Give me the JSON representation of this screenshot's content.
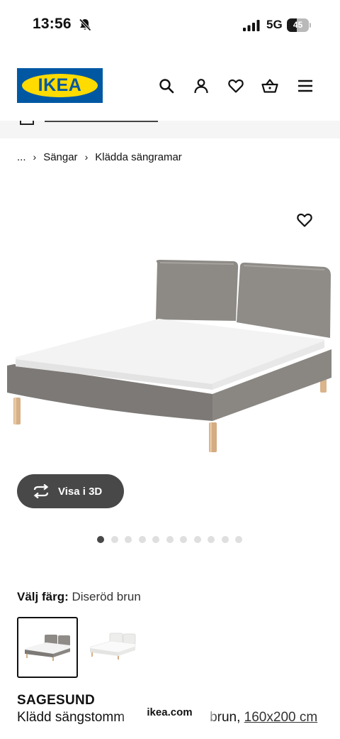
{
  "status_bar": {
    "time": "13:56",
    "network": "5G",
    "battery_percent": "45",
    "battery_level": 0.45,
    "icons": [
      "bell-muted-icon",
      "signal-icon",
      "battery-icon"
    ]
  },
  "header": {
    "logo_text": "IKEA",
    "brand_colors": {
      "blue": "#0058a3",
      "yellow": "#ffdb00"
    },
    "icons": [
      "search-icon",
      "account-icon",
      "heart-icon",
      "basket-icon",
      "menu-icon"
    ]
  },
  "breadcrumb": {
    "ellipsis": "...",
    "separator": "›",
    "items": [
      "Sängar",
      "Klädda sängramar"
    ]
  },
  "gallery": {
    "view_3d_label": "Visa i 3D",
    "dot_count": 11,
    "active_dot": 0,
    "favorite_icon": "heart-outline-icon"
  },
  "color_picker": {
    "label": "Välj färg:",
    "selected_value": "Diseröd brun",
    "swatches": [
      {
        "name": "Diseröd brun",
        "color": "#8a8784",
        "selected": true
      },
      {
        "name": "white",
        "color": "#f1f1ef",
        "selected": false
      }
    ]
  },
  "product": {
    "name": "SAGESUND",
    "description_start": "Klädd sängstomm",
    "description_end": "brun,",
    "size": "160x200 cm"
  },
  "browser": {
    "url": "ikea.com"
  }
}
